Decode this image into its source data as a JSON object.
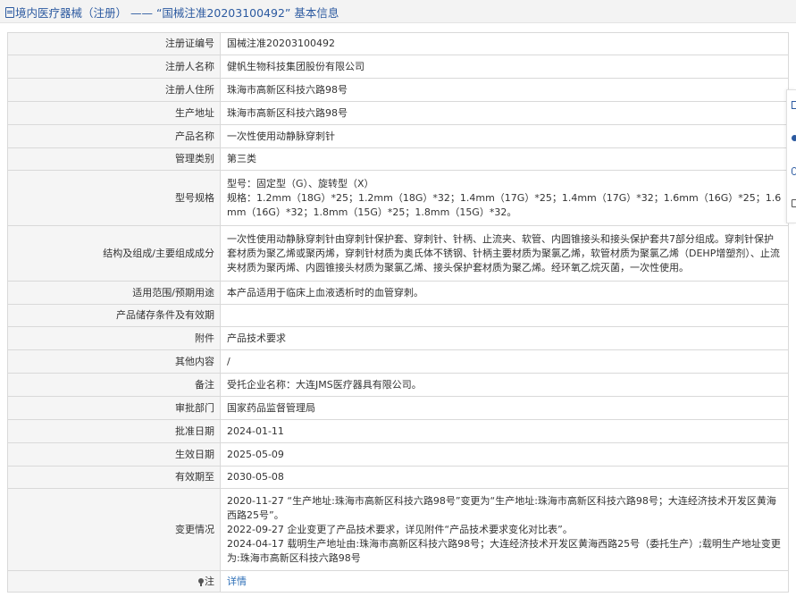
{
  "header": {
    "title": "境内医疗器械（注册） —— “国械注准20203100492” 基本信息"
  },
  "rows": [
    {
      "label": "注册证编号",
      "value": "国械注准20203100492"
    },
    {
      "label": "注册人名称",
      "value": "健帆生物科技集团股份有限公司"
    },
    {
      "label": "注册人住所",
      "value": "珠海市高新区科技六路98号"
    },
    {
      "label": "生产地址",
      "value": "珠海市高新区科技六路98号"
    },
    {
      "label": "产品名称",
      "value": "一次性使用动静脉穿刺针"
    },
    {
      "label": "管理类别",
      "value": "第三类"
    },
    {
      "label": "型号规格",
      "lines": [
        "型号：固定型（G）、旋转型（X）",
        "规格：1.2mm（18G）*25；1.2mm（18G）*32；1.4mm（17G）*25；1.4mm（17G）*32；1.6mm（16G）*25；1.6mm（16G）*32；1.8mm（15G）*25；1.8mm（15G）*32。"
      ]
    },
    {
      "label": "结构及组成/主要组成成分",
      "value": "一次性使用动静脉穿刺针由穿刺针保护套、穿刺针、针柄、止流夹、软管、内圆锥接头和接头保护套共7部分组成。穿刺针保护套材质为聚乙烯或聚丙烯，穿刺针材质为奥氏体不锈钢、针柄主要材质为聚氯乙烯，软管材质为聚氯乙烯（DEHP增塑剂）、止流夹材质为聚丙烯、内圆锥接头材质为聚氯乙烯、接头保护套材质为聚乙烯。经环氧乙烷灭菌，一次性使用。"
    },
    {
      "label": "适用范围/预期用途",
      "value": "本产品适用于临床上血液透析时的血管穿刺。"
    },
    {
      "label": "产品储存条件及有效期",
      "value": ""
    },
    {
      "label": "附件",
      "value": "产品技术要求"
    },
    {
      "label": "其他内容",
      "value": "/"
    },
    {
      "label": "备注",
      "value": "受托企业名称：大连JMS医疗器具有限公司。"
    },
    {
      "label": "审批部门",
      "value": "国家药品监督管理局"
    },
    {
      "label": "批准日期",
      "value": "2024-01-11"
    },
    {
      "label": "生效日期",
      "value": "2025-05-09"
    },
    {
      "label": "有效期至",
      "value": "2030-05-08"
    },
    {
      "label": "变更情况",
      "lines": [
        "2020-11-27 “生产地址:珠海市高新区科技六路98号”变更为“生产地址:珠海市高新区科技六路98号；大连经济技术开发区黄海西路25号”。",
        "2022-09-27 企业变更了产品技术要求，详见附件“产品技术要求变化对比表”。",
        "2024-04-17 载明生产地址由:珠海市高新区科技六路98号；大连经济技术开发区黄海西路25号（委托生产）;载明生产地址变更为:珠海市高新区科技六路98号"
      ]
    }
  ],
  "note": {
    "label": "注",
    "link": "详情"
  },
  "icons": {
    "header": "document-icon",
    "note": "pin-icon"
  }
}
